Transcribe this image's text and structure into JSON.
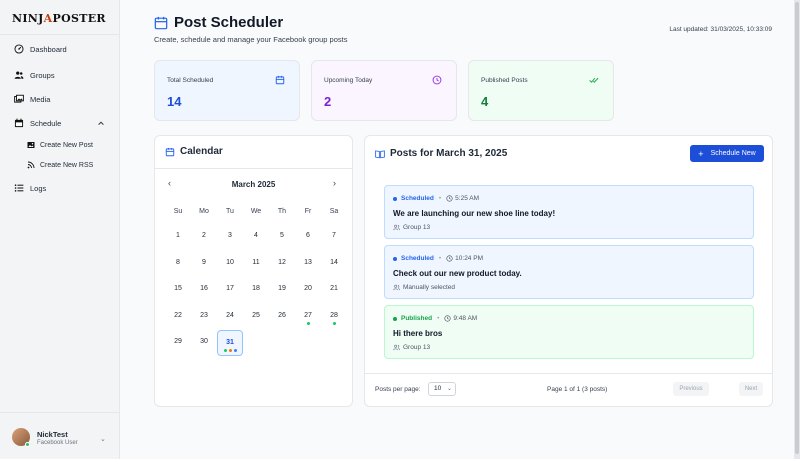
{
  "brand": {
    "logo_part1": "NINJ",
    "logo_part2": "A",
    "logo_part3": "POSTER"
  },
  "sidebar": {
    "items": [
      {
        "label": "Dashboard",
        "icon": "dashboard-icon"
      },
      {
        "label": "Groups",
        "icon": "users-icon"
      },
      {
        "label": "Media",
        "icon": "media-icon"
      },
      {
        "label": "Schedule",
        "icon": "calendar-icon"
      }
    ],
    "sub_items": [
      {
        "label": "Create New Post",
        "icon": "image-icon"
      },
      {
        "label": "Create New RSS",
        "icon": "rss-icon"
      }
    ],
    "logs_label": "Logs",
    "user": {
      "name": "NickTest",
      "role": "Facebook User"
    }
  },
  "header": {
    "title": "Post Scheduler",
    "subtitle": "Create, schedule and manage your Facebook group posts",
    "last_updated": "Last updated: 31/03/2025, 10:33:09"
  },
  "stats": [
    {
      "label": "Total Scheduled",
      "value": "14",
      "icon": "calendar-icon",
      "color": "#1d4ed8",
      "bg": "#eff6ff"
    },
    {
      "label": "Upcoming Today",
      "value": "2",
      "icon": "clock-icon",
      "color": "#7e22ce",
      "bg": "#faf5ff"
    },
    {
      "label": "Published Posts",
      "value": "4",
      "icon": "double-check-icon",
      "color": "#15803d",
      "bg": "#f0fdf4"
    }
  ],
  "calendar": {
    "title": "Calendar",
    "month": "March 2025",
    "prev": "‹",
    "next": "›",
    "weekdays": [
      "Su",
      "Mo",
      "Tu",
      "We",
      "Th",
      "Fr",
      "Sa"
    ],
    "weeks": [
      [
        "1",
        "2",
        "3",
        "4",
        "5",
        "6",
        "7"
      ],
      [
        "8",
        "9",
        "10",
        "11",
        "12",
        "13",
        "14"
      ],
      [
        "15",
        "16",
        "17",
        "18",
        "19",
        "20",
        "21"
      ],
      [
        "22",
        "23",
        "24",
        "25",
        "26",
        "27",
        "28"
      ],
      [
        "29",
        "30",
        "31"
      ]
    ],
    "selected_day": "31",
    "marked_days": {
      "27": [
        "#22c55e"
      ],
      "28": [
        "#22c55e"
      ],
      "31": [
        "#22c55e",
        "#f97316",
        "#3b82f6"
      ]
    }
  },
  "posts_panel": {
    "title": "Posts for March 31, 2025",
    "schedule_button": "Schedule New",
    "posts": [
      {
        "status": "Scheduled",
        "time": "5:25 AM",
        "text": "We are launching our new shoe line today!",
        "group": "Group 13",
        "group_icon": "users-icon",
        "status_color": "#2563eb",
        "bg": "#eff6ff",
        "border": "#bfdbfe"
      },
      {
        "status": "Scheduled",
        "time": "10:24 PM",
        "text": "Check out our new product today.",
        "group": "Manually selected",
        "group_icon": "users-icon",
        "status_color": "#2563eb",
        "bg": "#eff6ff",
        "border": "#bfdbfe"
      },
      {
        "status": "Published",
        "time": "9:48 AM",
        "text": "Hi there bros",
        "group": "Group 13",
        "group_icon": "users-icon",
        "status_color": "#16a34a",
        "bg": "#f0fdf4",
        "border": "#bbf7d0"
      }
    ],
    "per_page_label": "Posts per page:",
    "per_page_value": "10",
    "page_info": "Page 1 of 1 (3 posts)",
    "prev_label": "Previous",
    "next_label": "Next"
  }
}
